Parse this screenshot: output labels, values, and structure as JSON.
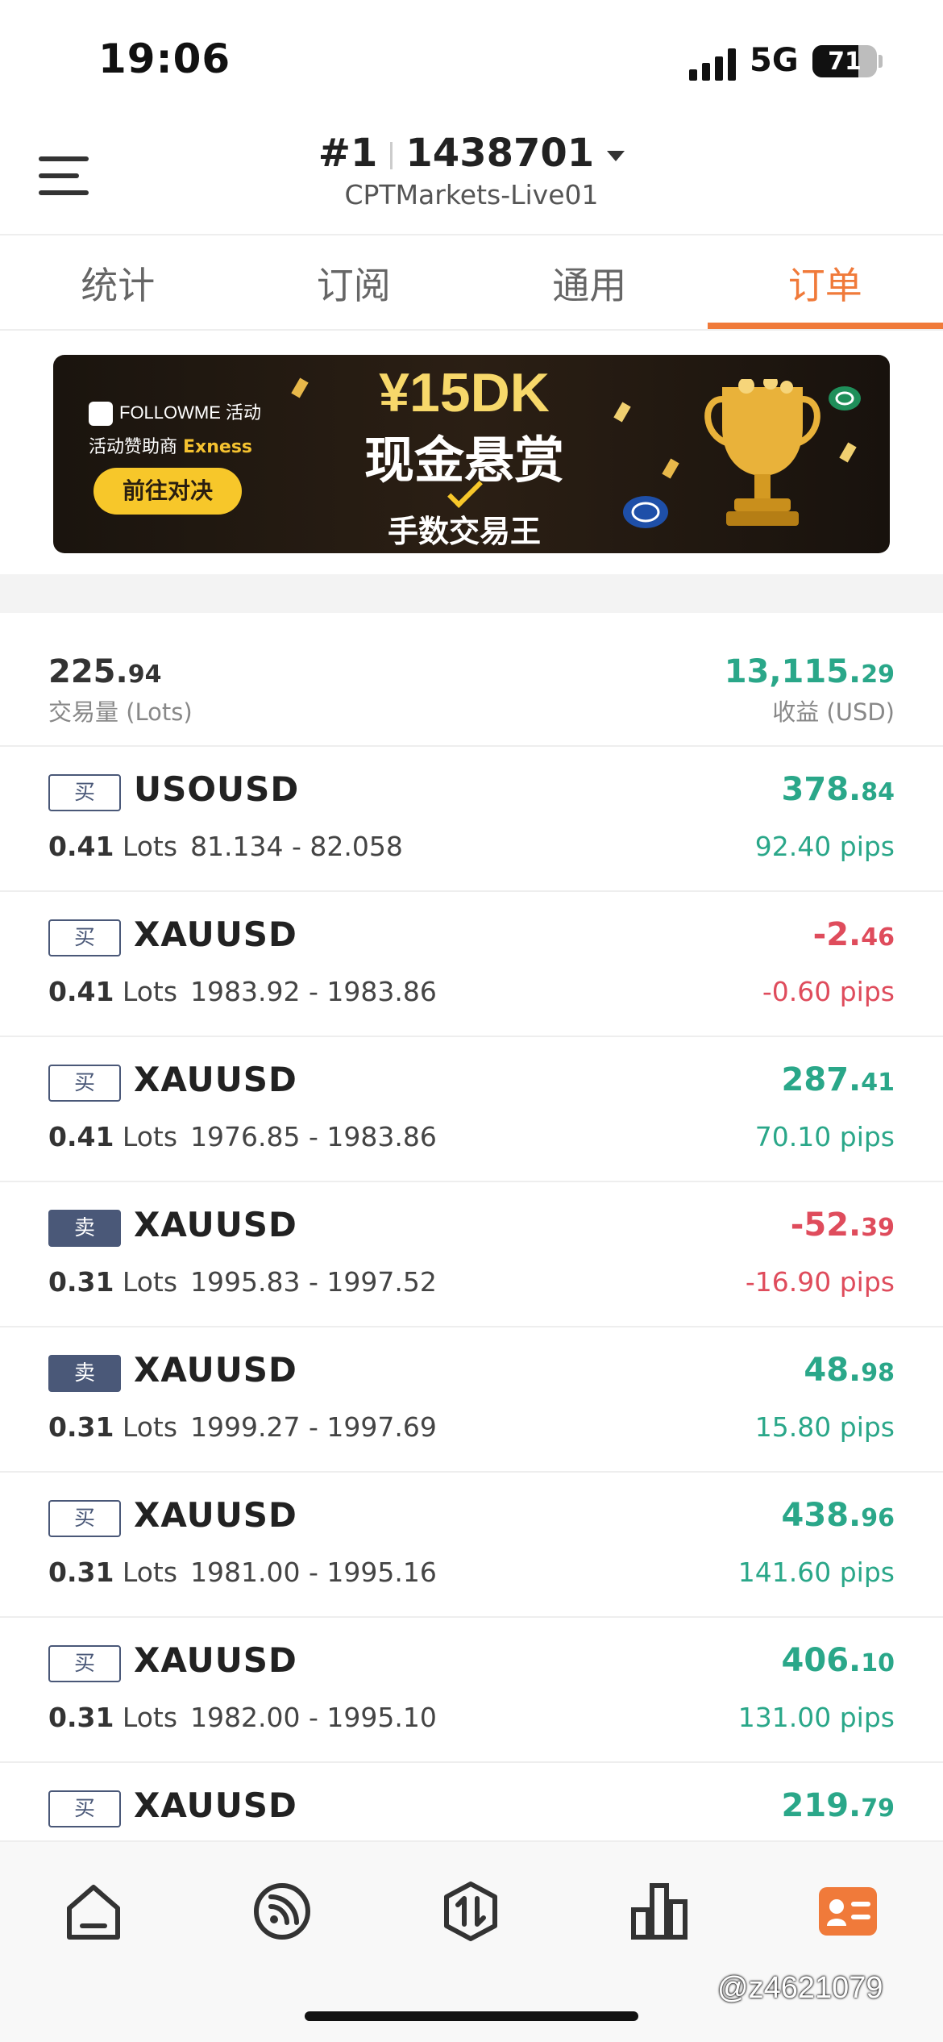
{
  "status_bar": {
    "time": "19:06",
    "network": "5G",
    "battery": "71"
  },
  "header": {
    "account_number": "#1",
    "account_id": "1438701",
    "server": "CPTMarkets-Live01"
  },
  "tabs": [
    {
      "label": "统计",
      "active": false
    },
    {
      "label": "订阅",
      "active": false
    },
    {
      "label": "通用",
      "active": false
    },
    {
      "label": "订单",
      "active": true
    }
  ],
  "banner": {
    "brand": "FOLLOWME 活动",
    "sponsor_prefix": "活动赞助商",
    "sponsor_name": "Exness",
    "cta": "前往对决",
    "headline": "¥15DK",
    "subline": "现金悬赏",
    "tagline": "手数交易王"
  },
  "summary": {
    "volume_int": "225.",
    "volume_dec": "94",
    "volume_label": "交易量 (Lots)",
    "profit_int": "13,115.",
    "profit_dec": "29",
    "profit_label": "收益 (USD)"
  },
  "orders": [
    {
      "side": "买",
      "symbol": "USOUSD",
      "lots": "0.41",
      "unit": "Lots",
      "prices": "81.134 - 82.058",
      "profit_int": "378.",
      "profit_dec": "84",
      "pips": "92.40 pips",
      "positive": true
    },
    {
      "side": "买",
      "symbol": "XAUUSD",
      "lots": "0.41",
      "unit": "Lots",
      "prices": "1983.92 - 1983.86",
      "profit_int": "-2.",
      "profit_dec": "46",
      "pips": "-0.60 pips",
      "positive": false
    },
    {
      "side": "买",
      "symbol": "XAUUSD",
      "lots": "0.41",
      "unit": "Lots",
      "prices": "1976.85 - 1983.86",
      "profit_int": "287.",
      "profit_dec": "41",
      "pips": "70.10 pips",
      "positive": true
    },
    {
      "side": "卖",
      "symbol": "XAUUSD",
      "lots": "0.31",
      "unit": "Lots",
      "prices": "1995.83 - 1997.52",
      "profit_int": "-52.",
      "profit_dec": "39",
      "pips": "-16.90 pips",
      "positive": false
    },
    {
      "side": "卖",
      "symbol": "XAUUSD",
      "lots": "0.31",
      "unit": "Lots",
      "prices": "1999.27 - 1997.69",
      "profit_int": "48.",
      "profit_dec": "98",
      "pips": "15.80 pips",
      "positive": true
    },
    {
      "side": "买",
      "symbol": "XAUUSD",
      "lots": "0.31",
      "unit": "Lots",
      "prices": "1981.00 - 1995.16",
      "profit_int": "438.",
      "profit_dec": "96",
      "pips": "141.60 pips",
      "positive": true
    },
    {
      "side": "买",
      "symbol": "XAUUSD",
      "lots": "0.31",
      "unit": "Lots",
      "prices": "1982.00 - 1995.10",
      "profit_int": "406.",
      "profit_dec": "10",
      "pips": "131.00 pips",
      "positive": true
    },
    {
      "side": "买",
      "symbol": "XAUUSD",
      "lots": "",
      "unit": "",
      "prices": "",
      "profit_int": "219.",
      "profit_dec": "79",
      "pips": "",
      "positive": true
    }
  ],
  "bottom_nav": [
    {
      "icon": "home-icon"
    },
    {
      "icon": "feed-icon"
    },
    {
      "icon": "trade-icon"
    },
    {
      "icon": "chart-icon"
    },
    {
      "icon": "profile-card-icon"
    }
  ],
  "watermark": "@z4621079",
  "colors": {
    "accent": "#f07a3a",
    "profit": "#2aa789",
    "loss": "#df4c5c",
    "badge": "#4a5878"
  }
}
